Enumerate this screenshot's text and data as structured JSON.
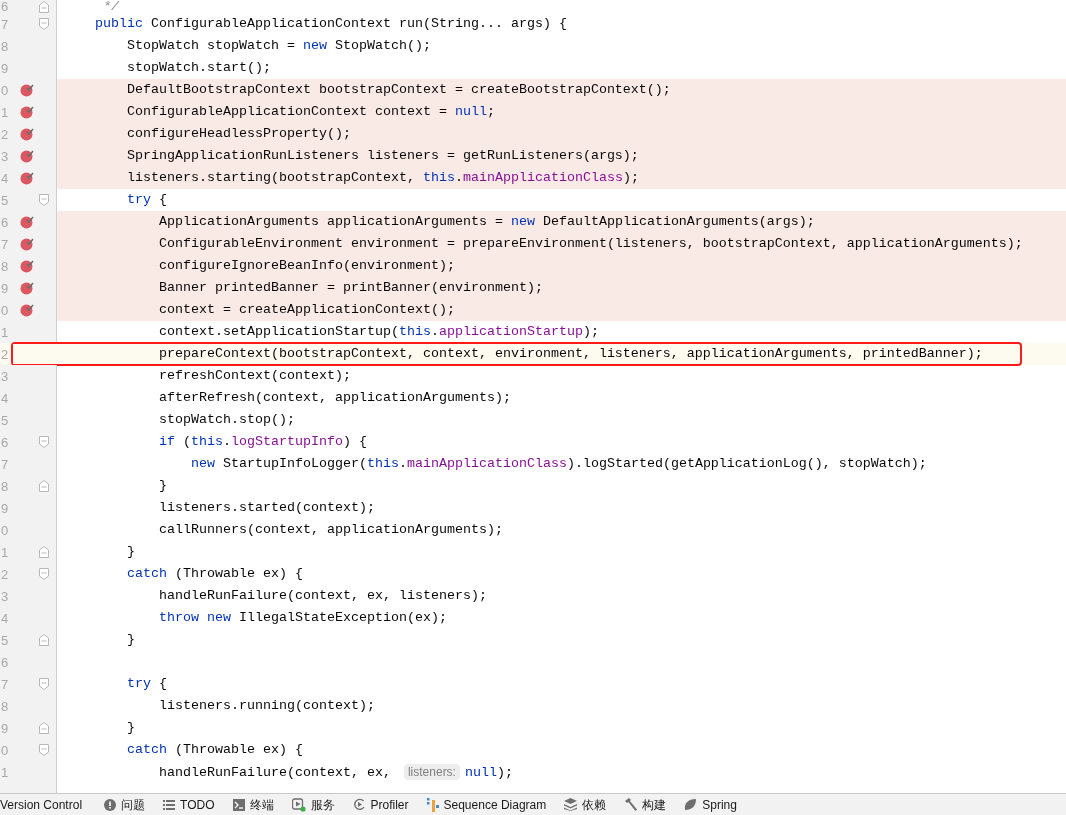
{
  "editor": {
    "lines": [
      {
        "num": "6",
        "fold_start": false,
        "fold_end": true,
        "breakpoint": false,
        "highlighted": false,
        "code": [
          {
            "kind": "comment",
            "text": "     */"
          }
        ]
      },
      {
        "num": "7",
        "fold_start": true,
        "fold_end": false,
        "breakpoint": false,
        "highlighted": false,
        "code": [
          {
            "kind": "keyword",
            "text": "    public"
          },
          {
            "kind": "plain",
            "text": " ConfigurableApplicationContext run(String... args) {"
          }
        ]
      },
      {
        "num": "8",
        "fold_start": false,
        "fold_end": false,
        "breakpoint": false,
        "highlighted": false,
        "code": [
          {
            "kind": "plain",
            "text": "        StopWatch stopWatch = "
          },
          {
            "kind": "keyword",
            "text": "new"
          },
          {
            "kind": "plain",
            "text": " StopWatch();"
          }
        ]
      },
      {
        "num": "9",
        "fold_start": false,
        "fold_end": false,
        "breakpoint": false,
        "highlighted": false,
        "code": [
          {
            "kind": "plain",
            "text": "        stopWatch.start();"
          }
        ]
      },
      {
        "num": "0",
        "fold_start": false,
        "fold_end": false,
        "breakpoint": true,
        "highlighted": false,
        "code": [
          {
            "kind": "plain",
            "text": "        DefaultBootstrapContext bootstrapContext = createBootstrapContext();"
          }
        ]
      },
      {
        "num": "1",
        "fold_start": false,
        "fold_end": false,
        "breakpoint": true,
        "highlighted": false,
        "code": [
          {
            "kind": "plain",
            "text": "        ConfigurableApplicationContext context = "
          },
          {
            "kind": "keyword",
            "text": "null"
          },
          {
            "kind": "plain",
            "text": ";"
          }
        ]
      },
      {
        "num": "2",
        "fold_start": false,
        "fold_end": false,
        "breakpoint": true,
        "highlighted": false,
        "code": [
          {
            "kind": "plain",
            "text": "        configureHeadlessProperty();"
          }
        ]
      },
      {
        "num": "3",
        "fold_start": false,
        "fold_end": false,
        "breakpoint": true,
        "highlighted": false,
        "code": [
          {
            "kind": "plain",
            "text": "        SpringApplicationRunListeners listeners = getRunListeners(args);"
          }
        ]
      },
      {
        "num": "4",
        "fold_start": false,
        "fold_end": false,
        "breakpoint": true,
        "highlighted": false,
        "code": [
          {
            "kind": "plain",
            "text": "        listeners.starting(bootstrapContext, "
          },
          {
            "kind": "keyword",
            "text": "this"
          },
          {
            "kind": "plain",
            "text": "."
          },
          {
            "kind": "field",
            "text": "mainApplicationClass"
          },
          {
            "kind": "plain",
            "text": ");"
          }
        ]
      },
      {
        "num": "5",
        "fold_start": true,
        "fold_end": false,
        "breakpoint": false,
        "highlighted": false,
        "code": [
          {
            "kind": "keyword",
            "text": "        try"
          },
          {
            "kind": "plain",
            "text": " {"
          }
        ]
      },
      {
        "num": "6",
        "fold_start": false,
        "fold_end": false,
        "breakpoint": true,
        "highlighted": false,
        "code": [
          {
            "kind": "plain",
            "text": "            ApplicationArguments applicationArguments = "
          },
          {
            "kind": "keyword",
            "text": "new"
          },
          {
            "kind": "plain",
            "text": " DefaultApplicationArguments(args);"
          }
        ]
      },
      {
        "num": "7",
        "fold_start": false,
        "fold_end": false,
        "breakpoint": true,
        "highlighted": false,
        "code": [
          {
            "kind": "plain",
            "text": "            ConfigurableEnvironment environment = prepareEnvironment(listeners, bootstrapContext, applicationArguments);"
          }
        ]
      },
      {
        "num": "8",
        "fold_start": false,
        "fold_end": false,
        "breakpoint": true,
        "highlighted": false,
        "code": [
          {
            "kind": "plain",
            "text": "            configureIgnoreBeanInfo(environment);"
          }
        ]
      },
      {
        "num": "9",
        "fold_start": false,
        "fold_end": false,
        "breakpoint": true,
        "highlighted": false,
        "code": [
          {
            "kind": "plain",
            "text": "            Banner printedBanner = printBanner(environment);"
          }
        ]
      },
      {
        "num": "0",
        "fold_start": false,
        "fold_end": false,
        "breakpoint": true,
        "highlighted": false,
        "code": [
          {
            "kind": "plain",
            "text": "            context = createApplicationContext();"
          }
        ]
      },
      {
        "num": "1",
        "fold_start": false,
        "fold_end": false,
        "breakpoint": false,
        "highlighted": false,
        "code": [
          {
            "kind": "plain",
            "text": "            context.setApplicationStartup("
          },
          {
            "kind": "keyword",
            "text": "this"
          },
          {
            "kind": "plain",
            "text": "."
          },
          {
            "kind": "field",
            "text": "applicationStartup"
          },
          {
            "kind": "plain",
            "text": ");"
          }
        ]
      },
      {
        "num": "2",
        "fold_start": false,
        "fold_end": false,
        "breakpoint": false,
        "highlighted": true,
        "code": [
          {
            "kind": "plain",
            "text": "            prepareContext(bootstrapContext, context, environment, listeners, applicationArguments, printedBanner);"
          }
        ]
      },
      {
        "num": "3",
        "fold_start": false,
        "fold_end": false,
        "breakpoint": false,
        "highlighted": false,
        "code": [
          {
            "kind": "plain",
            "text": "            refreshContext(context);"
          }
        ]
      },
      {
        "num": "4",
        "fold_start": false,
        "fold_end": false,
        "breakpoint": false,
        "highlighted": false,
        "code": [
          {
            "kind": "plain",
            "text": "            afterRefresh(context, applicationArguments);"
          }
        ]
      },
      {
        "num": "5",
        "fold_start": false,
        "fold_end": false,
        "breakpoint": false,
        "highlighted": false,
        "code": [
          {
            "kind": "plain",
            "text": "            stopWatch.stop();"
          }
        ]
      },
      {
        "num": "6",
        "fold_start": true,
        "fold_end": false,
        "breakpoint": false,
        "highlighted": false,
        "code": [
          {
            "kind": "keyword",
            "text": "            if"
          },
          {
            "kind": "plain",
            "text": " ("
          },
          {
            "kind": "keyword",
            "text": "this"
          },
          {
            "kind": "plain",
            "text": "."
          },
          {
            "kind": "field",
            "text": "logStartupInfo"
          },
          {
            "kind": "plain",
            "text": ") {"
          }
        ]
      },
      {
        "num": "7",
        "fold_start": false,
        "fold_end": false,
        "breakpoint": false,
        "highlighted": false,
        "code": [
          {
            "kind": "keyword",
            "text": "                new"
          },
          {
            "kind": "plain",
            "text": " StartupInfoLogger("
          },
          {
            "kind": "keyword",
            "text": "this"
          },
          {
            "kind": "plain",
            "text": "."
          },
          {
            "kind": "field",
            "text": "mainApplicationClass"
          },
          {
            "kind": "plain",
            "text": ").logStarted(getApplicationLog(), stopWatch);"
          }
        ]
      },
      {
        "num": "8",
        "fold_start": false,
        "fold_end": true,
        "breakpoint": false,
        "highlighted": false,
        "code": [
          {
            "kind": "plain",
            "text": "            }"
          }
        ]
      },
      {
        "num": "9",
        "fold_start": false,
        "fold_end": false,
        "breakpoint": false,
        "highlighted": false,
        "code": [
          {
            "kind": "plain",
            "text": "            listeners.started(context);"
          }
        ]
      },
      {
        "num": "0",
        "fold_start": false,
        "fold_end": false,
        "breakpoint": false,
        "highlighted": false,
        "code": [
          {
            "kind": "plain",
            "text": "            callRunners(context, applicationArguments);"
          }
        ]
      },
      {
        "num": "1",
        "fold_start": false,
        "fold_end": true,
        "breakpoint": false,
        "highlighted": false,
        "code": [
          {
            "kind": "plain",
            "text": "        }"
          }
        ]
      },
      {
        "num": "2",
        "fold_start": true,
        "fold_end": false,
        "breakpoint": false,
        "highlighted": false,
        "code": [
          {
            "kind": "keyword",
            "text": "        catch"
          },
          {
            "kind": "plain",
            "text": " (Throwable ex) {"
          }
        ]
      },
      {
        "num": "3",
        "fold_start": false,
        "fold_end": false,
        "breakpoint": false,
        "highlighted": false,
        "code": [
          {
            "kind": "plain",
            "text": "            handleRunFailure(context, ex, listeners);"
          }
        ]
      },
      {
        "num": "4",
        "fold_start": false,
        "fold_end": false,
        "breakpoint": false,
        "highlighted": false,
        "code": [
          {
            "kind": "keyword",
            "text": "            throw new"
          },
          {
            "kind": "plain",
            "text": " IllegalStateException(ex);"
          }
        ]
      },
      {
        "num": "5",
        "fold_start": false,
        "fold_end": true,
        "breakpoint": false,
        "highlighted": false,
        "code": [
          {
            "kind": "plain",
            "text": "        }"
          }
        ]
      },
      {
        "num": "6",
        "fold_start": false,
        "fold_end": false,
        "breakpoint": false,
        "highlighted": false
      },
      {
        "num": "7",
        "fold_start": true,
        "fold_end": false,
        "breakpoint": false,
        "highlighted": false,
        "code": [
          {
            "kind": "keyword",
            "text": "        try"
          },
          {
            "kind": "plain",
            "text": " {"
          }
        ]
      },
      {
        "num": "8",
        "fold_start": false,
        "fold_end": false,
        "breakpoint": false,
        "highlighted": false,
        "code": [
          {
            "kind": "plain",
            "text": "            listeners.running(context);"
          }
        ]
      },
      {
        "num": "9",
        "fold_start": false,
        "fold_end": true,
        "breakpoint": false,
        "highlighted": false,
        "code": [
          {
            "kind": "plain",
            "text": "        }"
          }
        ]
      },
      {
        "num": "0",
        "fold_start": true,
        "fold_end": false,
        "breakpoint": false,
        "highlighted": false,
        "code": [
          {
            "kind": "keyword",
            "text": "        catch"
          },
          {
            "kind": "plain",
            "text": " (Throwable ex) {"
          }
        ]
      },
      {
        "num": "1",
        "fold_start": false,
        "fold_end": false,
        "breakpoint": false,
        "highlighted": false,
        "code": [
          {
            "kind": "plain",
            "text": "            handleRunFailure(context, ex, "
          },
          {
            "kind": "hint",
            "text": "listeners:"
          },
          {
            "kind": "keyword",
            "text": "null"
          },
          {
            "kind": "plain",
            "text": ");"
          }
        ]
      }
    ]
  },
  "status_bar": {
    "items": [
      {
        "label": "Version Control"
      },
      {
        "label": "问题"
      },
      {
        "label": "TODO"
      },
      {
        "label": "终端"
      },
      {
        "label": "服务"
      },
      {
        "label": "Profiler"
      },
      {
        "label": "Sequence Diagram"
      },
      {
        "label": "依赖"
      },
      {
        "label": "构建"
      },
      {
        "label": "Spring"
      }
    ]
  }
}
